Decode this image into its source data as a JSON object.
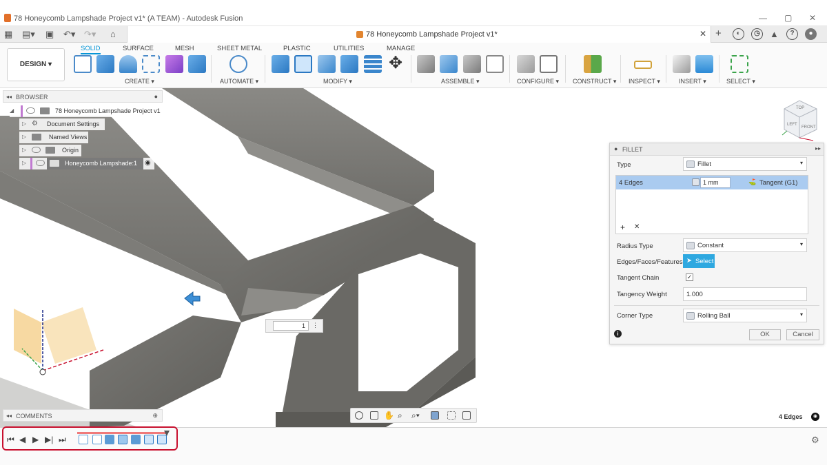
{
  "window": {
    "title": "78 Honeycomb Lampshade Project v1* (A TEAM) - Autodesk Fusion",
    "controls": [
      "—",
      "▢",
      "✕"
    ]
  },
  "doc_tab": {
    "name": "78 Honeycomb Lampshade Project v1*",
    "close": "✕"
  },
  "toolbar": {
    "workspace": "DESIGN",
    "tabs": [
      "SOLID",
      "SURFACE",
      "MESH",
      "SHEET METAL",
      "PLASTIC",
      "UTILITIES",
      "MANAGE"
    ],
    "groups": [
      "CREATE",
      "AUTOMATE",
      "MODIFY",
      "ASSEMBLE",
      "CONFIGURE",
      "CONSTRUCT",
      "INSPECT",
      "INSERT",
      "SELECT"
    ]
  },
  "browser": {
    "header": "BROWSER",
    "items": [
      {
        "label": "78 Honeycomb Lampshade Project v1"
      },
      {
        "label": "Document Settings"
      },
      {
        "label": "Named Views"
      },
      {
        "label": "Origin"
      },
      {
        "label": "Honeycomb Lampshade:1"
      }
    ]
  },
  "fillet": {
    "header": "FILLET",
    "type_label": "Type",
    "type_value": "Fillet",
    "edges_label": "4 Edges",
    "radius": "1 mm",
    "continuity": "Tangent (G1)",
    "radius_type_label": "Radius Type",
    "radius_type_value": "Constant",
    "efx_label": "Edges/Faces/Features",
    "select_label": "Select",
    "tangent_chain_label": "Tangent Chain",
    "tangent_chain_checked": true,
    "tangency_weight_label": "Tangency Weight",
    "tangency_weight_value": "1.000",
    "corner_type_label": "Corner Type",
    "corner_type_value": "Rolling Ball",
    "ok": "OK",
    "cancel": "Cancel",
    "add": "+",
    "remove": "✕"
  },
  "viewport": {
    "value_input": "1",
    "edge_count": "4 Edges",
    "viewcube": {
      "top": "TOP",
      "front": "FRONT",
      "left": "LEFT"
    }
  },
  "comments": {
    "header": "COMMENTS"
  }
}
